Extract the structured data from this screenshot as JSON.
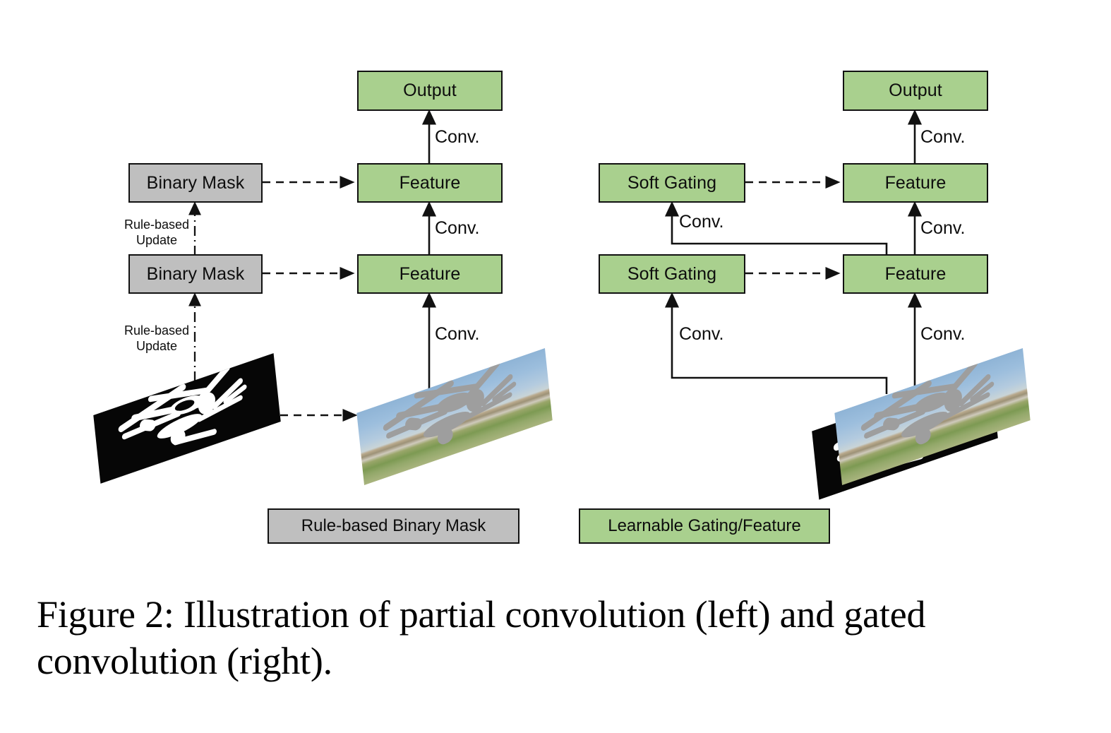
{
  "figure": {
    "caption": "Figure 2: Illustration of partial convolution (left) and gated convolution (right)."
  },
  "colors": {
    "learnable_green": "#a9d08e",
    "rule_gray": "#bfbfbf",
    "stroke_black": "#111111",
    "mask_background": "#060606",
    "mask_stroke": "#ffffff",
    "photo_mask_overlay": "#9e9e9e"
  },
  "left_panel": {
    "name": "Partial Convolution",
    "nodes": {
      "output": "Output",
      "feature_top": "Feature",
      "feature_bottom": "Feature",
      "mask_top": "Binary Mask",
      "mask_bottom": "Binary Mask"
    },
    "edge_labels": {
      "conv_output": "Conv.",
      "conv_feature_mid": "Conv.",
      "conv_feature_bottom": "Conv.",
      "rule_update_top": "Rule-based\nUpdate",
      "rule_update_top_line1": "Rule-based",
      "rule_update_top_line2": "Update",
      "rule_update_bottom_line1": "Rule-based",
      "rule_update_bottom_line2": "Update"
    },
    "images": {
      "binary_mask_plate": "binary-mask-image",
      "masked_photo_plate": "masked-photo-image"
    }
  },
  "right_panel": {
    "name": "Gated Convolution",
    "nodes": {
      "output": "Output",
      "feature_top": "Feature",
      "feature_bottom": "Feature",
      "gating_top": "Soft Gating",
      "gating_bottom": "Soft Gating"
    },
    "edge_labels": {
      "conv_output": "Conv.",
      "conv_feature_mid": "Conv.",
      "conv_feature_bottom": "Conv.",
      "conv_gating_mid": "Conv.",
      "conv_gating_bottom": "Conv."
    },
    "images": {
      "binary_mask_plate": "binary-mask-image",
      "masked_photo_plate": "masked-photo-image"
    }
  },
  "legend": {
    "items": [
      {
        "label": "Rule-based Binary Mask",
        "swatch": "#bfbfbf"
      },
      {
        "label": "Learnable Gating/Feature",
        "swatch": "#a9d08e"
      }
    ],
    "rule_based_label": "Rule-based Binary Mask",
    "learnable_label": "Learnable Gating/Feature"
  }
}
